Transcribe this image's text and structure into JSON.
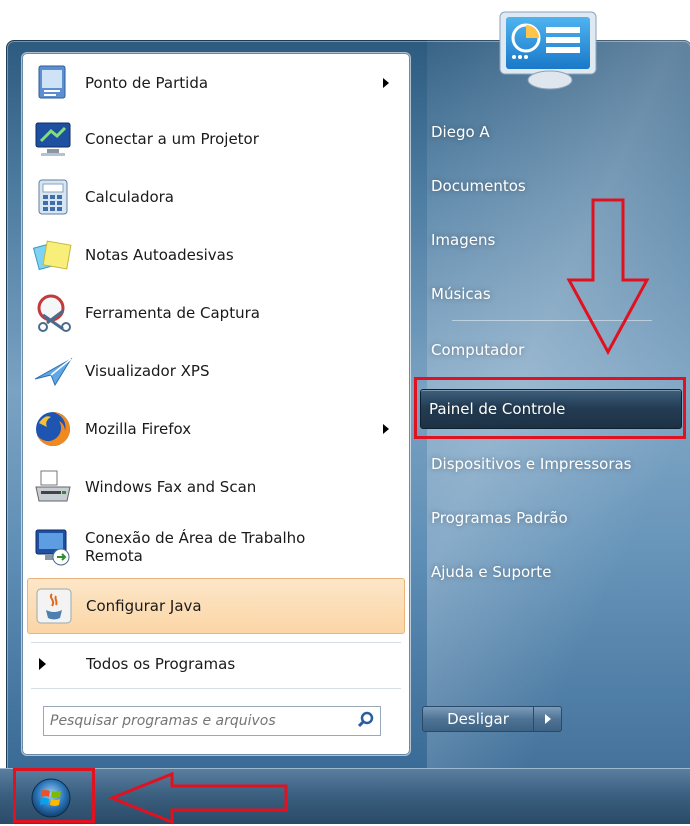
{
  "left_programs": [
    {
      "label": "Ponto de Partida",
      "icon": "getting-started-icon",
      "submenu": true
    },
    {
      "label": "Conectar a um Projetor",
      "icon": "projector-icon",
      "submenu": false
    },
    {
      "label": "Calculadora",
      "icon": "calculator-icon",
      "submenu": false
    },
    {
      "label": "Notas Autoadesivas",
      "icon": "sticky-notes-icon",
      "submenu": false
    },
    {
      "label": "Ferramenta de Captura",
      "icon": "snipping-tool-icon",
      "submenu": false
    },
    {
      "label": "Visualizador XPS",
      "icon": "xps-viewer-icon",
      "submenu": false
    },
    {
      "label": "Mozilla Firefox",
      "icon": "firefox-icon",
      "submenu": true
    },
    {
      "label": "Windows Fax and Scan",
      "icon": "fax-scan-icon",
      "submenu": false
    },
    {
      "label": "Conexão de Área de Trabalho\nRemota",
      "icon": "remote-desktop-icon",
      "submenu": false
    },
    {
      "label": "Configurar Java",
      "icon": "java-icon",
      "submenu": false,
      "highlighted": true
    }
  ],
  "all_programs": {
    "label": "Todos os Programas"
  },
  "search": {
    "placeholder": "Pesquisar programas e arquivos",
    "icon": "search-icon"
  },
  "right_items": [
    {
      "label": "Diego A"
    },
    {
      "label": "Documentos"
    },
    {
      "label": "Imagens"
    },
    {
      "label": "Músicas"
    },
    {
      "label": "Computador"
    },
    {
      "label": "Painel de Controle",
      "active": true
    },
    {
      "label": "Dispositivos e Impressoras"
    },
    {
      "label": "Programas Padrão"
    },
    {
      "label": "Ajuda e Suporte"
    }
  ],
  "shutdown": {
    "label": "Desligar",
    "more_icon": "chevron-right-icon"
  },
  "user_picture": {
    "icon": "user-tile-icon"
  },
  "start_button": {
    "icon": "windows-orb-icon"
  },
  "annotations": {
    "color": "#e0121f"
  }
}
